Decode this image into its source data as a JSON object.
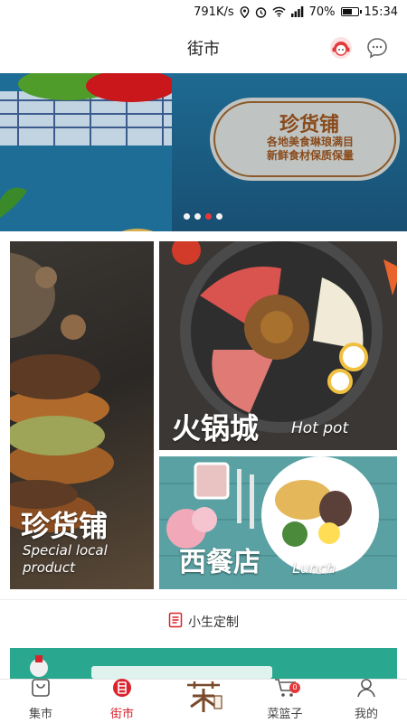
{
  "status_bar": {
    "speed": "791K/s",
    "battery": "70%",
    "battery_level": 0.7,
    "time": "15:34"
  },
  "header": {
    "title": "街市"
  },
  "banner": {
    "title": "珍货铺",
    "line1": "各地美食琳琅满目",
    "line2": "新鲜食材保质保量",
    "dots": 4,
    "active_dot": 2
  },
  "tiles": [
    {
      "cn": "珍货铺",
      "en1": "Special local",
      "en2": "product"
    },
    {
      "cn": "火锅城",
      "en": "Hot pot"
    },
    {
      "cn": "西餐店",
      "en": "Lunch"
    }
  ],
  "section": {
    "title": "小生定制"
  },
  "tabs": [
    {
      "label": "集市",
      "icon": "bag-icon"
    },
    {
      "label": "街市",
      "icon": "street-badge-icon"
    },
    {
      "label": "",
      "icon": "logo-icon"
    },
    {
      "label": "菜篮子",
      "icon": "cart-icon",
      "badge": "0"
    },
    {
      "label": "我的",
      "icon": "user-icon"
    }
  ],
  "colors": {
    "accent": "#e4393c",
    "banner_text": "#8a4b1c",
    "promo": "#2aa88f"
  }
}
